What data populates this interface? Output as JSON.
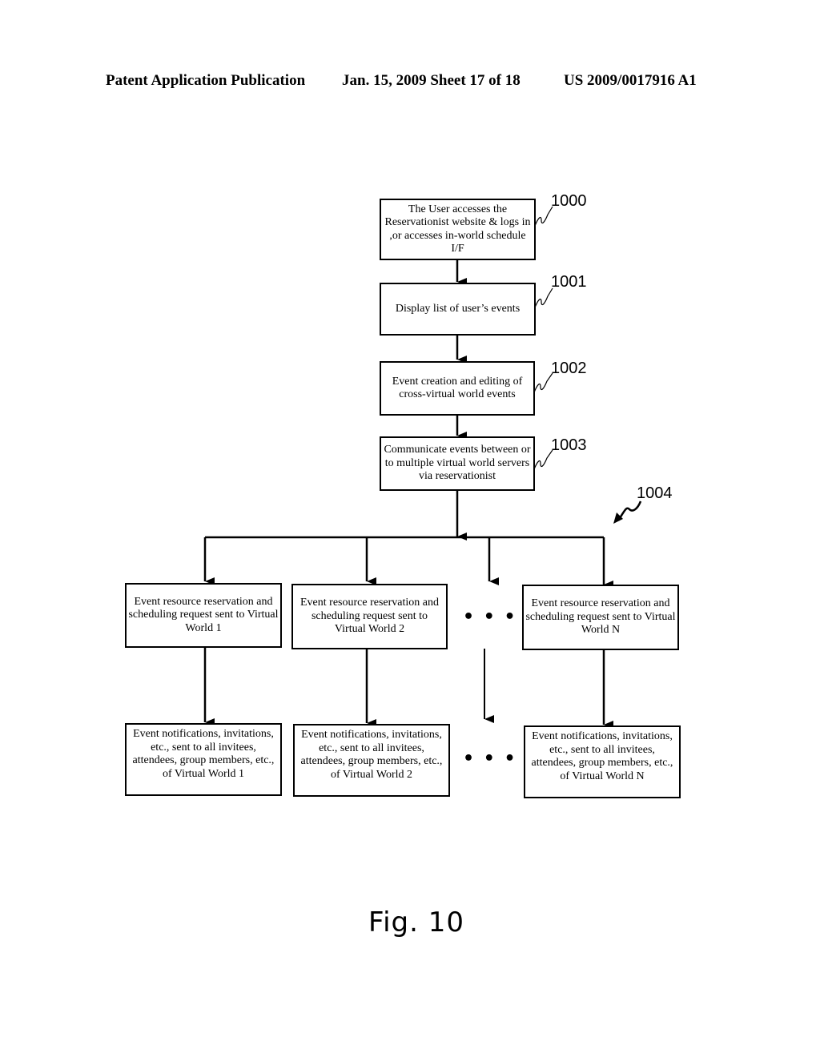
{
  "header": {
    "publication": "Patent Application Publication",
    "date_sheet": "Jan. 15, 2009  Sheet 17 of 18",
    "number": "US 2009/0017916 A1"
  },
  "flow": {
    "steps": [
      {
        "ref": "1000",
        "text": "The User accesses the Reservationist website & logs in ,or accesses in-world schedule I/F"
      },
      {
        "ref": "1001",
        "text": "Display list of user’s events"
      },
      {
        "ref": "1002",
        "text": "Event creation and editing of cross-virtual world events"
      },
      {
        "ref": "1003",
        "text": "Communicate events between or to multiple virtual world servers via reservationist"
      }
    ],
    "branch_ref": "1004",
    "requests": [
      "Event resource reservation and scheduling request sent to Virtual World 1",
      "Event resource reservation and scheduling request sent to Virtual World 2",
      "Event resource reservation and scheduling request sent to Virtual World N"
    ],
    "notifications": [
      "Event notifications, invitations, etc., sent to all invitees, attendees, group members, etc., of Virtual World 1",
      "Event notifications, invitations, etc., sent to all invitees, attendees, group members, etc., of Virtual World 2",
      "Event notifications, invitations, etc., sent to all invitees, attendees, group members, etc., of Virtual World N"
    ],
    "ellipsis": "• • •"
  },
  "figure_label": "Fig.  10"
}
